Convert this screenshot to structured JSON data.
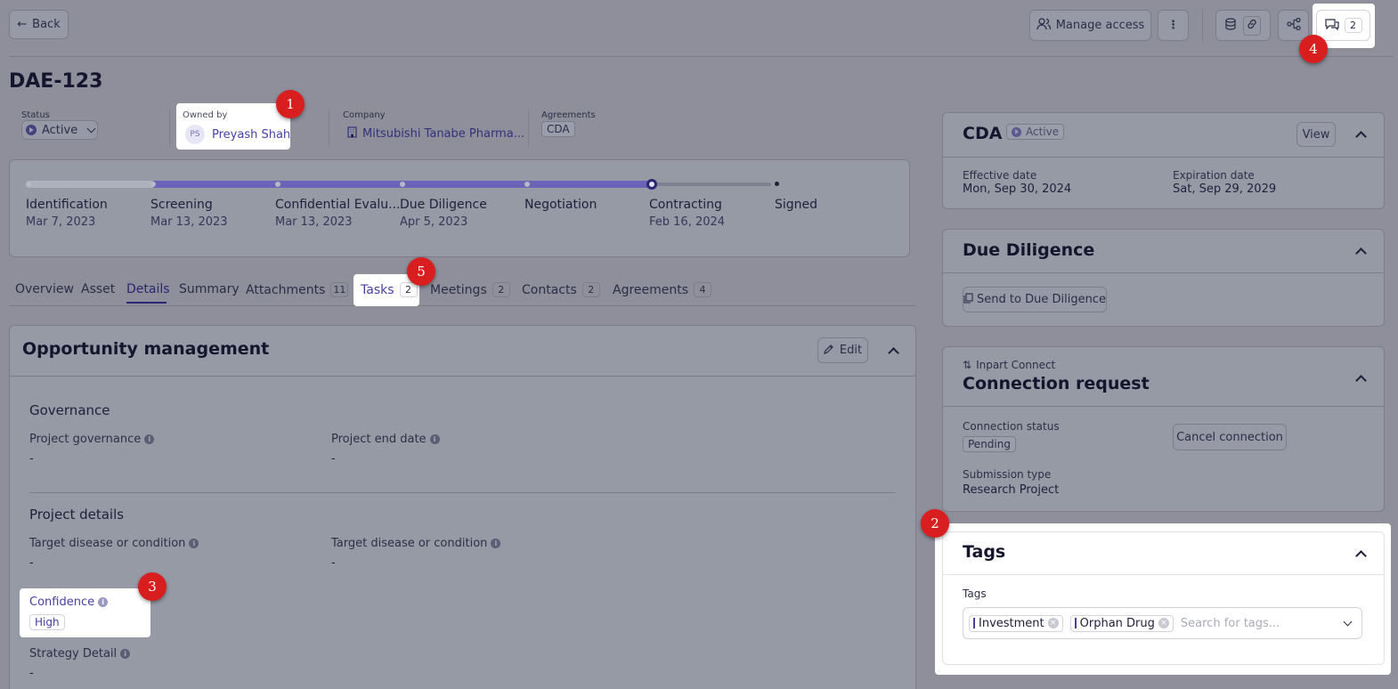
{
  "header": {
    "back_label": "Back",
    "manage_access_label": "Manage access",
    "comments_count": "2"
  },
  "record": {
    "id": "DAE-123",
    "status_label": "Status",
    "status_value": "Active",
    "owned_by_label": "Owned by",
    "owner_initials": "PS",
    "owner_name": "Preyash Shah",
    "company_label": "Company",
    "company_value": "Mitsubishi Tanabe Pharma...",
    "agreements_label": "Agreements",
    "agreements_value": "CDA"
  },
  "stages": [
    {
      "name": "Identification",
      "date": "Mar 7, 2023"
    },
    {
      "name": "Screening",
      "date": "Mar 13, 2023"
    },
    {
      "name": "Confidential Evalu...",
      "date": "Mar 13, 2023"
    },
    {
      "name": "Due Diligence",
      "date": "Apr 5, 2023"
    },
    {
      "name": "Negotiation",
      "date": ""
    },
    {
      "name": "Contracting",
      "date": "Feb 16, 2024"
    },
    {
      "name": "Signed",
      "date": ""
    }
  ],
  "tabs": [
    {
      "label": "Overview",
      "count": ""
    },
    {
      "label": "Asset",
      "count": ""
    },
    {
      "label": "Details",
      "count": ""
    },
    {
      "label": "Summary",
      "count": ""
    },
    {
      "label": "Attachments",
      "count": "11"
    },
    {
      "label": "Tasks",
      "count": "2"
    },
    {
      "label": "Meetings",
      "count": "2"
    },
    {
      "label": "Contacts",
      "count": "2"
    },
    {
      "label": "Agreements",
      "count": "4"
    }
  ],
  "opportunity": {
    "title": "Opportunity management",
    "edit_label": "Edit",
    "governance_heading": "Governance",
    "project_governance_label": "Project governance",
    "project_governance_value": "-",
    "project_end_date_label": "Project end date",
    "project_end_date_value": "-",
    "project_details_heading": "Project details",
    "target_disease_label_1": "Target disease or condition",
    "target_disease_value_1": "-",
    "target_disease_label_2": "Target disease or condition",
    "target_disease_value_2": "-",
    "confidence_label": "Confidence",
    "confidence_value": "High",
    "strategy_detail_label": "Strategy Detail",
    "strategy_detail_value": "-"
  },
  "cda": {
    "title": "CDA",
    "status": "Active",
    "view_label": "View",
    "effective_date_label": "Effective date",
    "effective_date_value": "Mon, Sep 30, 2024",
    "expiration_date_label": "Expiration date",
    "expiration_date_value": "Sat, Sep 29, 2029"
  },
  "due_diligence": {
    "title": "Due Diligence",
    "send_label": "Send to Due Diligence"
  },
  "connection": {
    "eyebrow": "Inpart Connect",
    "title": "Connection request",
    "status_label": "Connection status",
    "status_value": "Pending",
    "cancel_label": "Cancel connection",
    "submission_type_label": "Submission type",
    "submission_type_value": "Research Project"
  },
  "tags": {
    "title": "Tags",
    "field_label": "Tags",
    "items": [
      "Investment",
      "Orphan Drug"
    ],
    "placeholder": "Search for tags..."
  },
  "markers": [
    "1",
    "2",
    "3",
    "4",
    "5"
  ]
}
